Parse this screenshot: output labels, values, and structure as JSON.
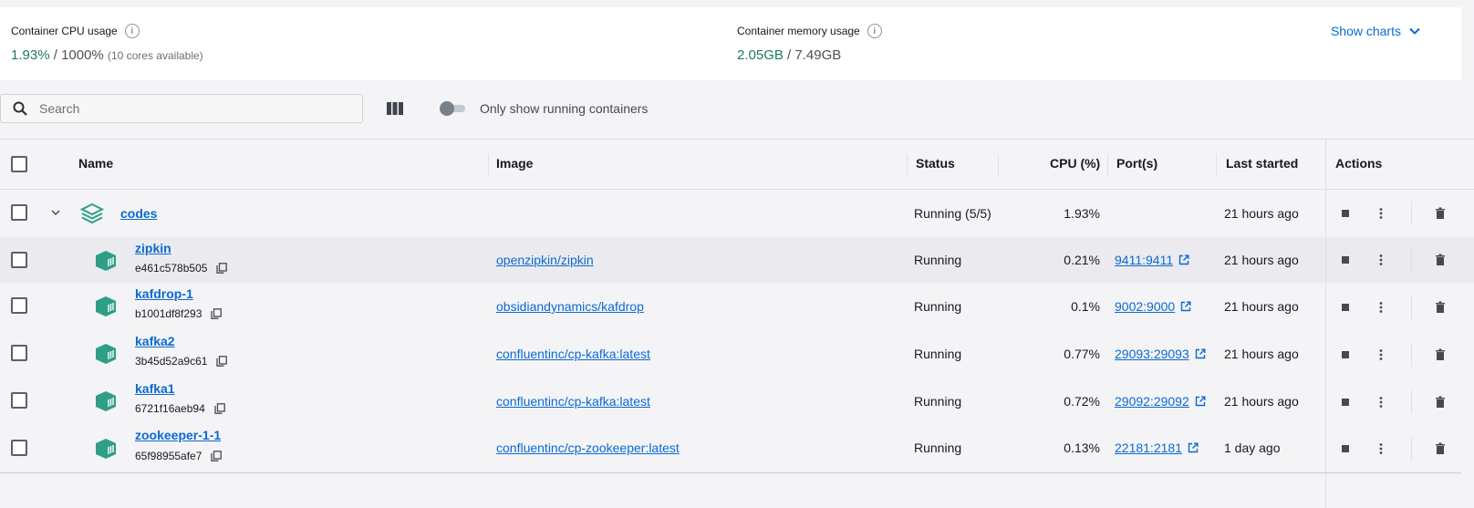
{
  "stats": {
    "cpu": {
      "label": "Container CPU usage",
      "value": "1.93%",
      "separator": "/",
      "total": "1000%",
      "note": "(10 cores available)"
    },
    "memory": {
      "label": "Container memory usage",
      "value": "2.05GB",
      "separator": "/",
      "total": "7.49GB"
    },
    "show_charts": "Show charts"
  },
  "toolbar": {
    "search_placeholder": "Search",
    "toggle_label": "Only show running containers"
  },
  "table": {
    "headers": {
      "name": "Name",
      "image": "Image",
      "status": "Status",
      "cpu": "CPU (%)",
      "ports": "Port(s)",
      "last_started": "Last started",
      "actions": "Actions"
    },
    "group": {
      "name": "codes",
      "status": "Running (5/5)",
      "cpu": "1.93%",
      "last_started": "21 hours ago"
    },
    "rows": [
      {
        "name": "zipkin",
        "id": "e461c578b505",
        "image": "openzipkin/zipkin",
        "status": "Running",
        "cpu": "0.21%",
        "ports": "9411:9411",
        "last_started": "21 hours ago"
      },
      {
        "name": "kafdrop-1",
        "id": "b1001df8f293",
        "image": "obsidiandynamics/kafdrop",
        "status": "Running",
        "cpu": "0.1%",
        "ports": "9002:9000",
        "last_started": "21 hours ago"
      },
      {
        "name": "kafka2",
        "id": "3b45d52a9c61",
        "image": "confluentinc/cp-kafka:latest",
        "status": "Running",
        "cpu": "0.77%",
        "ports": "29093:29093",
        "last_started": "21 hours ago"
      },
      {
        "name": "kafka1",
        "id": "6721f16aeb94",
        "image": "confluentinc/cp-kafka:latest",
        "status": "Running",
        "cpu": "0.72%",
        "ports": "29092:29092",
        "last_started": "21 hours ago"
      },
      {
        "name": "zookeeper-1-1",
        "id": "65f98955afe7",
        "image": "confluentinc/cp-zookeeper:latest",
        "status": "Running",
        "cpu": "0.13%",
        "ports": "22181:2181",
        "last_started": "1 day ago"
      }
    ]
  },
  "icons": {
    "stack": "stack-icon",
    "container": "container-icon",
    "stop": "stop-icon",
    "more": "more-vertical-icon",
    "delete": "trash-icon",
    "copy": "copy-icon",
    "external": "external-link-icon"
  },
  "colors": {
    "accent": "#1e7a5a",
    "link": "#0b6ad1",
    "container_icon": "#2e9f86"
  }
}
